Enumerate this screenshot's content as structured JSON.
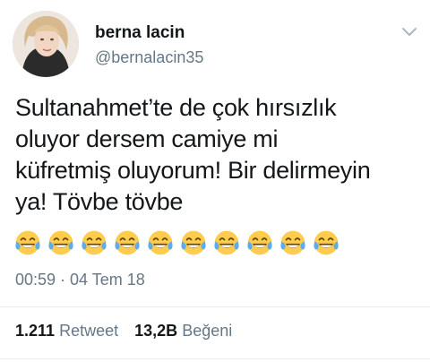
{
  "user": {
    "display_name": "berna lacin",
    "handle": "@bernalacin35",
    "avatar_icon": "profile-photo"
  },
  "menu": {
    "icon": "chevron-down-icon"
  },
  "tweet": {
    "lines": [
      "Sultanahmet’te de çok hırsızlık",
      "oluyor dersem camiye mi",
      "küfretmiş oluyorum! Bir delirmeyin",
      "ya! Tövbe tövbe"
    ],
    "emoji": "face-with-tears-of-joy",
    "emoji_count": 10,
    "timestamp": "00:59 · 04 Tem 18"
  },
  "stats": {
    "retweets_count": "1.211",
    "retweets_label": "Retweet",
    "likes_count": "13,2B",
    "likes_label": "Beğeni"
  },
  "colors": {
    "text": "#14171a",
    "secondary": "#657786",
    "divider": "#e6ecf0",
    "emoji_face": "#ffcc4d",
    "emoji_tears": "#5dadec"
  }
}
